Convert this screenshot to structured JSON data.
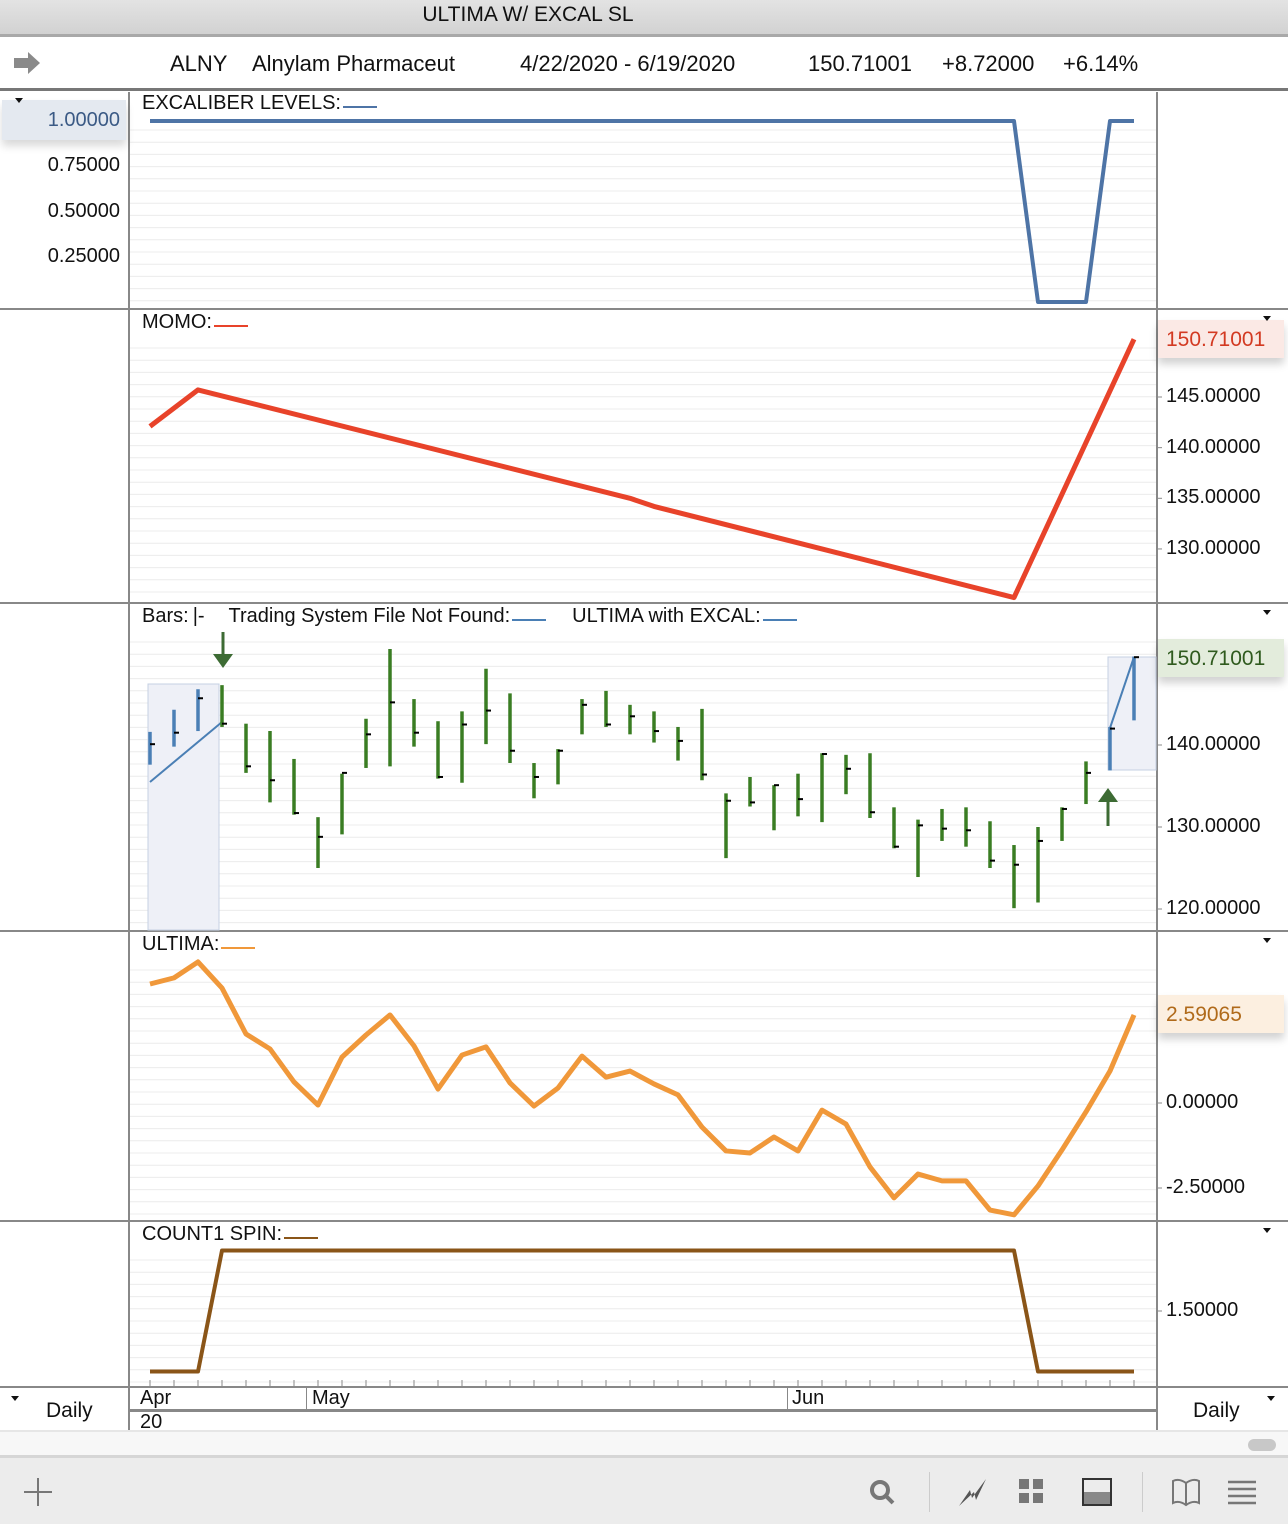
{
  "window_title": "ULTIMA W/ EXCAL SL",
  "header": {
    "symbol": "ALNY",
    "name": "Alnylam Pharmaceut",
    "date_range": "4/22/2020 - 6/19/2020",
    "last": "150.71001",
    "change": "+8.72000",
    "pct_change": "+6.14%"
  },
  "xaxis": {
    "months": [
      "Apr",
      "May",
      "Jun"
    ],
    "year": "20",
    "period_left": "Daily",
    "period_right": "Daily"
  },
  "colors": {
    "excal": "#4e74a6",
    "momo": "#e8432a",
    "bars_up": "#3a7d23",
    "bars_hist": "#4a7fb5",
    "ultima": "#f0983a",
    "count": "#8a5518"
  },
  "chart_data": [
    {
      "id": "excal",
      "type": "line",
      "title": "EXCALIBER LEVELS:",
      "ticks": [
        "1.00000",
        "0.75000",
        "0.50000",
        "0.25000"
      ],
      "highlight": "1.00000",
      "values": [
        1,
        1,
        1,
        1,
        1,
        1,
        1,
        1,
        1,
        1,
        1,
        1,
        1,
        1,
        1,
        1,
        1,
        1,
        1,
        1,
        1,
        1,
        1,
        1,
        1,
        1,
        1,
        1,
        1,
        1,
        1,
        1,
        1,
        1,
        1,
        1,
        1,
        0,
        0,
        0,
        1,
        1
      ]
    },
    {
      "id": "momo",
      "type": "line",
      "title": "MOMO:",
      "ticks": [
        "145.00000",
        "140.00000",
        "135.00000",
        "130.00000"
      ],
      "last": "150.71001",
      "points": [
        [
          0,
          142.1
        ],
        [
          2,
          145.7
        ],
        [
          20,
          135.0
        ],
        [
          21,
          134.2
        ],
        [
          36,
          125.2
        ],
        [
          41,
          150.71
        ]
      ]
    },
    {
      "id": "bars",
      "type": "ohlc",
      "title": "Bars:",
      "bar_style": "|-",
      "system_label": "Trading System File Not Found:",
      "ultima_label": "ULTIMA with EXCAL:",
      "ticks": [
        "140.00000",
        "130.00000",
        "120.00000"
      ],
      "last": "150.71001",
      "high": [
        141.6,
        144.3,
        146.8,
        147.3,
        142.6,
        141.7,
        138.3,
        131.2,
        136.5,
        143.2,
        151.7,
        145.6,
        142.9,
        144.1,
        149.3,
        146.3,
        137.8,
        139.5,
        145.6,
        146.6,
        144.9,
        144.1,
        142.2,
        144.4,
        134.1,
        136.1,
        135.1,
        136.5,
        139.0,
        138.8,
        139.0,
        132.4,
        130.9,
        132.2,
        132.4,
        130.7,
        127.8,
        130.0,
        132.4,
        138.0,
        142.2,
        150.8
      ],
      "low": [
        137.6,
        139.8,
        141.7,
        142.2,
        136.6,
        133.0,
        131.5,
        125.0,
        129.1,
        137.2,
        137.4,
        139.8,
        135.9,
        135.4,
        140.1,
        137.8,
        133.5,
        135.2,
        141.3,
        142.2,
        141.3,
        140.3,
        138.1,
        135.7,
        126.2,
        132.5,
        129.6,
        131.3,
        130.6,
        134.0,
        131.1,
        127.4,
        123.9,
        128.3,
        127.6,
        125.0,
        120.1,
        120.8,
        128.3,
        132.8,
        136.9,
        143.0
      ],
      "close": [
        140.1,
        141.5,
        145.7,
        142.6,
        137.4,
        135.7,
        131.7,
        128.8,
        136.6,
        141.3,
        145.2,
        141.5,
        136.1,
        142.5,
        144.2,
        139.3,
        136.1,
        139.3,
        144.9,
        142.5,
        143.5,
        141.7,
        140.5,
        136.4,
        133.2,
        133.0,
        135.1,
        133.4,
        138.9,
        137.1,
        131.8,
        127.6,
        130.2,
        129.8,
        129.6,
        125.9,
        125.4,
        128.3,
        132.2,
        136.6,
        142.0,
        150.71
      ],
      "highlighted_bars": [
        0,
        1,
        2,
        3,
        40,
        41
      ],
      "sell_signal_bar": 3,
      "buy_signal_bar": 40
    },
    {
      "id": "ultima",
      "type": "line",
      "title": "ULTIMA:",
      "ticks": [
        "0.00000",
        "-2.50000"
      ],
      "last": "2.59065",
      "values": [
        3.5,
        3.68,
        4.15,
        3.38,
        2.03,
        1.59,
        0.62,
        -0.06,
        1.35,
        2.0,
        2.59,
        1.68,
        0.41,
        1.41,
        1.65,
        0.59,
        -0.09,
        0.44,
        1.38,
        0.76,
        0.94,
        0.56,
        0.24,
        -0.71,
        -1.41,
        -1.47,
        -1.0,
        -1.41,
        -0.21,
        -0.62,
        -1.88,
        -2.79,
        -2.09,
        -2.29,
        -2.29,
        -3.15,
        -3.29,
        -2.44,
        -1.38,
        -0.26,
        0.94,
        2.59
      ]
    },
    {
      "id": "count",
      "type": "line",
      "title": "COUNT1 SPIN:",
      "ticks": [
        "1.50000"
      ],
      "values": [
        1,
        1,
        1,
        2,
        2,
        2,
        2,
        2,
        2,
        2,
        2,
        2,
        2,
        2,
        2,
        2,
        2,
        2,
        2,
        2,
        2,
        2,
        2,
        2,
        2,
        2,
        2,
        2,
        2,
        2,
        2,
        2,
        2,
        2,
        2,
        2,
        2,
        1,
        1,
        1,
        1,
        1
      ]
    }
  ]
}
